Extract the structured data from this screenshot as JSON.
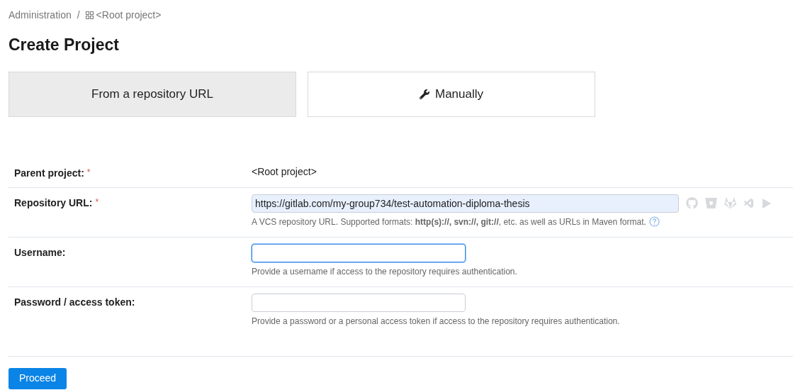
{
  "breadcrumb": [
    {
      "label": "Administration",
      "kind": "link"
    },
    {
      "label": "<Root project>",
      "kind": "project",
      "separator": "/"
    }
  ],
  "title": "Create Project",
  "tabs": [
    {
      "label": "From a repository URL",
      "selected": true,
      "kind": "url"
    },
    {
      "label": "Manually",
      "selected": false,
      "kind": "manual"
    }
  ],
  "form": {
    "rows": [
      {
        "label": "Parent project:",
        "required_mark": "*",
        "kind": "text",
        "value": "<Root project>"
      },
      {
        "label": "Repository URL:",
        "required_mark": "*",
        "kind": "url",
        "value": "https://gitlab.com/my-group734/test-automation-diploma-thesis",
        "focused": false,
        "help": "A VCS repository URL. Supported formats: **http(s)://, svn://, git://**, etc. as well as URLs in Maven format."
      },
      {
        "label": "Username:",
        "kind": "input",
        "value": "",
        "focused": true,
        "help": "Provide a username if access to the repository requires authentication."
      },
      {
        "label": "Password / access token:",
        "kind": "input",
        "value": "",
        "focused": false,
        "help": "Provide a password or a personal access token if access to the repository requires authentication."
      }
    ]
  },
  "submit": "Proceed"
}
